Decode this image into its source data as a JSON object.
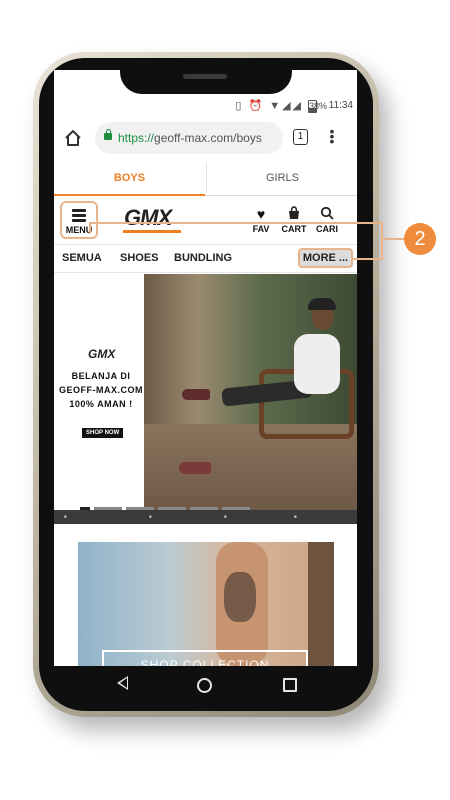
{
  "status_bar": {
    "battery": "38%",
    "time": "11:34"
  },
  "browser": {
    "url_scheme": "https://",
    "url_host": "geoff-max.com/boys",
    "tab_count": "1"
  },
  "gender_tabs": [
    {
      "label": "BOYS",
      "active": true
    },
    {
      "label": "GIRLS",
      "active": false
    }
  ],
  "header": {
    "menu_label": "MENU",
    "logo": "GMX",
    "icons": [
      {
        "name": "heart-icon",
        "label": "FAV"
      },
      {
        "name": "bag-icon",
        "label": "CART"
      },
      {
        "name": "search-icon",
        "label": "CARI"
      }
    ]
  },
  "categories": [
    "SEMUA",
    "SHOES",
    "BUNDLING"
  ],
  "more_label": "MORE ...",
  "hero": {
    "logo": "GMX",
    "line1": "BELANJA DI",
    "line2": "GEOFF-MAX.COM",
    "line3": "100% AMAN !",
    "button": "SHOP NOW"
  },
  "banner2_label": "SHOP COLLECTION",
  "callout_number": "2",
  "colors": {
    "accent": "#ef7f22",
    "highlight": "#e7b48c"
  }
}
